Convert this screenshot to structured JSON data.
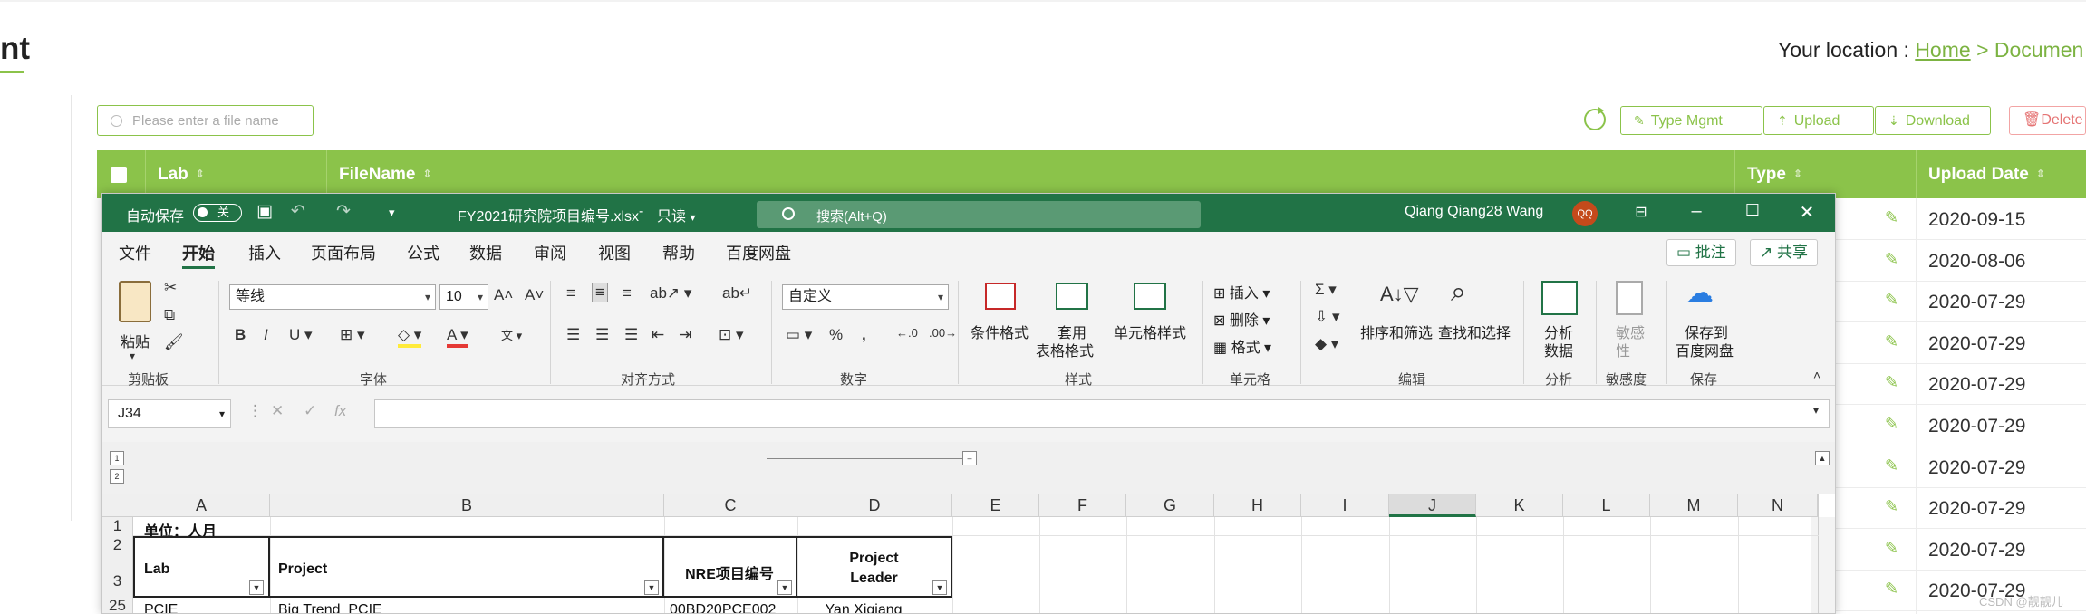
{
  "page": {
    "title_partial": "nt",
    "location_label": "Your location : ",
    "breadcrumb_home": "Home",
    "breadcrumb_sep": ">",
    "breadcrumb_current": "Documen",
    "search_placeholder": "Please enter a file name",
    "buttons": {
      "type_mgmt": "Type Mgmt",
      "upload": "Upload",
      "download": "Download",
      "delete": "Delete"
    },
    "table": {
      "headers": {
        "lab": "Lab",
        "filename": "FileName",
        "type": "Type",
        "upload_date": "Upload Date"
      },
      "dates": [
        "2020-09-15",
        "2020-08-06",
        "2020-07-29",
        "2020-07-29",
        "2020-07-29",
        "2020-07-29",
        "2020-07-29",
        "2020-07-29",
        "2020-07-29",
        "2020-07-29"
      ]
    },
    "watermark": "CSDN @靓靓儿"
  },
  "excel": {
    "autosave_label": "自动保存",
    "autosave_state": "关",
    "file_title": "FY2021研究院项目编号.xlsx",
    "mode": "只读",
    "search_placeholder": "搜索(Alt+Q)",
    "user_name": "Qiang Qiang28 Wang",
    "user_initials": "QQ",
    "menu": [
      "文件",
      "开始",
      "插入",
      "页面布局",
      "公式",
      "数据",
      "审阅",
      "视图",
      "帮助",
      "百度网盘"
    ],
    "comment_btn": "批注",
    "share_btn": "共享",
    "ribbon": {
      "paste": "粘贴",
      "font_name": "等线",
      "font_size": "10",
      "number_format": "自定义",
      "cond_format": "条件格式",
      "table_format_1": "套用",
      "table_format_2": "表格格式",
      "cell_style": "单元格样式",
      "insert": "插入",
      "delete": "删除",
      "format": "格式",
      "sort_filter": "排序和筛选",
      "find_select": "查找和选择",
      "analyze_1": "分析",
      "analyze_2": "数据",
      "sensitivity_1": "敏感",
      "sensitivity_2": "性",
      "save_baidu_1": "保存到",
      "save_baidu_2": "百度网盘",
      "groups": [
        "剪贴板",
        "字体",
        "对齐方式",
        "数字",
        "样式",
        "单元格",
        "编辑",
        "分析",
        "敏感度",
        "保存"
      ]
    },
    "name_box": "J34",
    "outline_levels": [
      "1",
      "2"
    ],
    "columns": [
      "A",
      "B",
      "C",
      "D",
      "E",
      "F",
      "G",
      "H",
      "I",
      "J",
      "K",
      "L",
      "M",
      "N"
    ],
    "rows": [
      "1",
      "2",
      "3",
      "25"
    ],
    "cells": {
      "a1": "单位：人月",
      "lab": "Lab",
      "project": "Project",
      "nre": "NRE项目编号",
      "leader_1": "Project",
      "leader_2": "Leader",
      "r25_a": "PCIE",
      "r25_b": "Big Trend_PCIE",
      "r25_c": "00BD20PCE002",
      "r25_d": "Yan Xiqiang"
    }
  }
}
